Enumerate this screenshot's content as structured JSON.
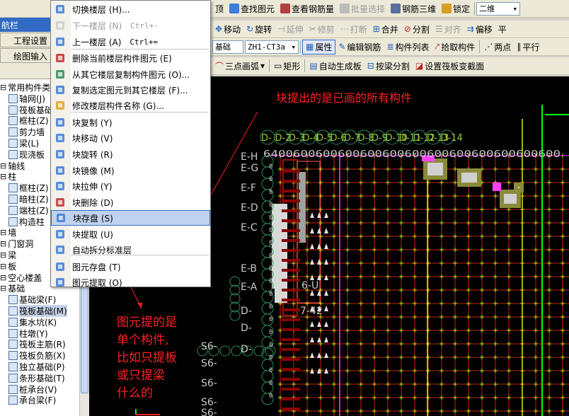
{
  "menu": {
    "items": [
      {
        "label": "切换楼层 (H)...",
        "shortcut": "",
        "icon": "switch-floor-icon",
        "disabled": false
      },
      {
        "label": "下一楼层 (N)",
        "shortcut": "Ctrl+-",
        "icon": "next-floor-icon",
        "disabled": true
      },
      {
        "label": "上一楼层 (A)",
        "shortcut": "Ctrl+=",
        "icon": "prev-floor-icon",
        "disabled": false
      },
      {
        "label": "删除当前楼层构件图元 (E)",
        "shortcut": "",
        "icon": "delete-floor-elements-icon",
        "disabled": false
      },
      {
        "label": "从其它楼层复制构件图元 (O)...",
        "shortcut": "",
        "icon": "copy-from-floor-icon",
        "disabled": false
      },
      {
        "label": "复制选定图元到其它楼层 (F)...",
        "shortcut": "",
        "icon": "copy-to-floor-icon",
        "disabled": false
      },
      {
        "label": "修改楼层构件名称 (G)...",
        "shortcut": "",
        "icon": "rename-icon",
        "disabled": false
      },
      {
        "label": "块复制 (Y)",
        "shortcut": "",
        "icon": "block-copy-icon",
        "disabled": false
      },
      {
        "label": "块移动 (V)",
        "shortcut": "",
        "icon": "block-move-icon",
        "disabled": false
      },
      {
        "label": "块旋转 (R)",
        "shortcut": "",
        "icon": "block-rotate-icon",
        "disabled": false
      },
      {
        "label": "块镜像 (M)",
        "shortcut": "",
        "icon": "block-mirror-icon",
        "disabled": false
      },
      {
        "label": "块拉伸 (Y)",
        "shortcut": "",
        "icon": "block-stretch-icon",
        "disabled": false
      },
      {
        "label": "块删除 (D)",
        "shortcut": "",
        "icon": "block-delete-icon",
        "disabled": false
      },
      {
        "label": "块存盘 (S)",
        "shortcut": "",
        "icon": "block-save-icon",
        "disabled": false,
        "highlighted": true
      },
      {
        "label": "块提取 (U)",
        "shortcut": "",
        "icon": "block-extract-icon",
        "disabled": false
      },
      {
        "label": "自动拆分标准层",
        "shortcut": "",
        "icon": "auto-split-icon",
        "disabled": false
      },
      {
        "label": "图元存盘 (T)",
        "shortcut": "",
        "icon": "element-save-icon",
        "disabled": false
      },
      {
        "label": "图元提取 (O)",
        "shortcut": "",
        "icon": "element-extract-icon",
        "disabled": false
      }
    ]
  },
  "toolbar1": {
    "items": [
      "顶",
      "查找图元",
      "查看钢筋量",
      "批量选择",
      "钢筋三维",
      "锁定"
    ],
    "view_mode": "二维"
  },
  "toolbar2": {
    "items": [
      "移动",
      "旋转",
      "延伸",
      "修剪",
      "打断",
      "合并",
      "分割",
      "对齐",
      "偏移",
      "平"
    ]
  },
  "toolbar3": {
    "combo1": "基础",
    "combo2": "ZH1-CT3a",
    "items": [
      "属性",
      "编辑钢筋",
      "构件列表",
      "拾取构件",
      "两点",
      "平行"
    ]
  },
  "toolbar4": {
    "items": [
      "三点画弧",
      "矩形",
      "自动生成板",
      "按梁分割",
      "设置筏板变截面"
    ]
  },
  "nav": {
    "title": "航栏",
    "settings_btn": "工程设置",
    "draw_btn": "绘图输入"
  },
  "tree": {
    "items": [
      {
        "label": "常用构件类",
        "level": 0
      },
      {
        "label": "轴网(J)",
        "level": 1
      },
      {
        "label": "筏板基础",
        "level": 1
      },
      {
        "label": "框柱(Z)",
        "level": 1
      },
      {
        "label": "剪力墙",
        "level": 1
      },
      {
        "label": "梁(L)",
        "level": 1
      },
      {
        "label": "现浇板",
        "level": 1
      },
      {
        "label": "轴线",
        "level": 0
      },
      {
        "label": "柱",
        "level": 0
      },
      {
        "label": "框柱(Z)",
        "level": 1
      },
      {
        "label": "暗柱(Z)",
        "level": 1
      },
      {
        "label": "端柱(Z)",
        "level": 1
      },
      {
        "label": "构造柱",
        "level": 1
      },
      {
        "label": "墙",
        "level": 0
      },
      {
        "label": "门窗洞",
        "level": 0
      },
      {
        "label": "梁",
        "level": 0
      },
      {
        "label": "板",
        "level": 0
      },
      {
        "label": "空心楼盖",
        "level": 0
      },
      {
        "label": "基础",
        "level": 0
      },
      {
        "label": "基础梁(F)",
        "level": 1
      },
      {
        "label": "筏板基础(M)",
        "level": 1,
        "selected": true
      },
      {
        "label": "集水坑(K)",
        "level": 1
      },
      {
        "label": "柱墩(Y)",
        "level": 1
      },
      {
        "label": "筏板主筋(R)",
        "level": 1
      },
      {
        "label": "筏板负筋(X)",
        "level": 1
      },
      {
        "label": "独立基础(P)",
        "level": 1
      },
      {
        "label": "条形基础(T)",
        "level": 1
      },
      {
        "label": "桩承台(V)",
        "level": 1
      },
      {
        "label": "承台梁(F)",
        "level": 1
      }
    ]
  },
  "canvas": {
    "axis_top": [
      "D-",
      "D-2",
      "D-3",
      "D-4",
      "D-5",
      "D-6",
      "D-7",
      "D-8",
      "D-9",
      "D-10",
      "D-11",
      "D-12",
      "D-13",
      "D-14"
    ],
    "axis_left": [
      "E-H",
      "E-G",
      "E-F",
      "E-D",
      "E-C",
      "E-B",
      "E-A"
    ],
    "labels_misc": [
      "6-U",
      "7-42",
      "S6-",
      "S6-",
      "S6-",
      "S6-",
      "S6-",
      "D-",
      "D-",
      "D-"
    ],
    "dim_text": "6400600600600600600600600600600600600600",
    "annotation_top": "块提出的是已画的所有构件",
    "annotation_bottom": [
      "图元提的是",
      "单个构件,",
      "比如只提板",
      "或只提梁",
      "什么的"
    ]
  },
  "colors": {
    "menu_highlight": "#c1d2ee",
    "annotation": "#ff2020",
    "grid_red": "#d01818",
    "grid_yellow": "#e8e800",
    "axis_green": "#00ff00",
    "canvas_bg": "#000000"
  }
}
